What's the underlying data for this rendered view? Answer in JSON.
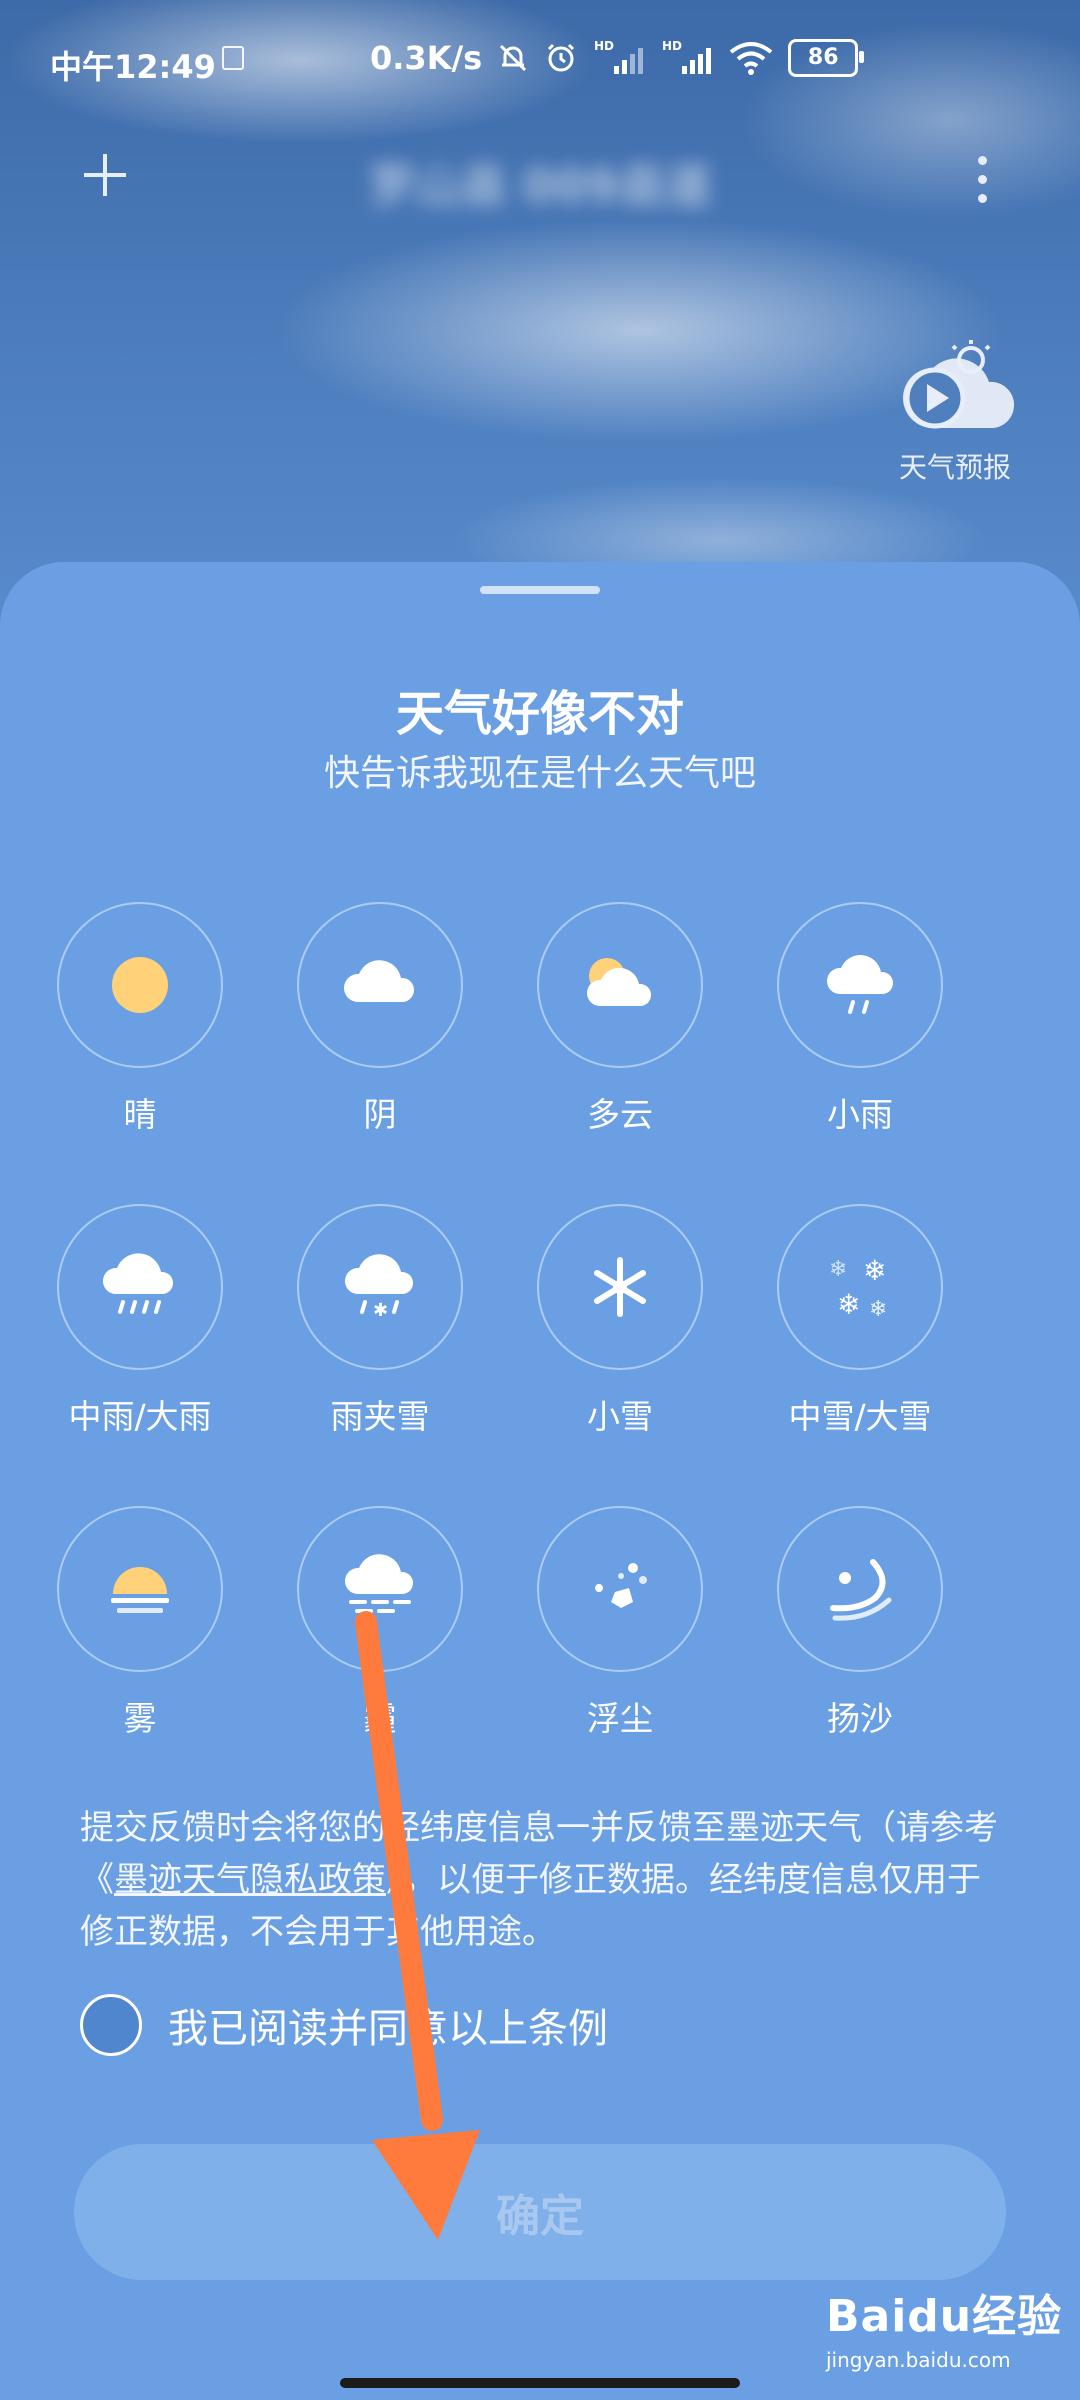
{
  "status_bar": {
    "time": "中午12:49",
    "net_speed": "0.3K/s",
    "signal_tag_1": "HD",
    "signal_tag_2": "HD",
    "battery": "86"
  },
  "header": {
    "city_blurred": "罗山县 009县道",
    "forecast_label": "天气预报"
  },
  "sheet": {
    "title": "天气好像不对",
    "subtitle": "快告诉我现在是什么天气吧",
    "options": [
      {
        "label": "晴",
        "icon": "sun-icon"
      },
      {
        "label": "阴",
        "icon": "cloud-icon"
      },
      {
        "label": "多云",
        "icon": "partly-cloudy-icon"
      },
      {
        "label": "小雨",
        "icon": "light-rain-icon"
      },
      {
        "label": "中雨/大雨",
        "icon": "heavy-rain-icon"
      },
      {
        "label": "雨夹雪",
        "icon": "sleet-icon"
      },
      {
        "label": "小雪",
        "icon": "snowflake-icon"
      },
      {
        "label": "中雪/大雪",
        "icon": "heavy-snow-icon"
      },
      {
        "label": "雾",
        "icon": "fog-icon"
      },
      {
        "label": "霾",
        "icon": "haze-icon"
      },
      {
        "label": "浮尘",
        "icon": "dust-icon"
      },
      {
        "label": "扬沙",
        "icon": "sandstorm-icon"
      }
    ],
    "notice_part1": "提交反馈时会将您的经纬度信息一并反馈至墨迹天气（请参考《",
    "notice_link": "墨迹天气隐私政策",
    "notice_part2": "》，以便于修正数据。经纬度信息仅用于修正数据，不会用于其他用途。",
    "agree_label": "我已阅读并同意以上条例",
    "confirm_label": "确定"
  },
  "watermark": {
    "brand": "Baidu经验",
    "url": "jingyan.baidu.com"
  },
  "colors": {
    "sheet_bg": "#6aa0e3",
    "sun": "#ffd27a",
    "arrow": "#ff7a3d"
  }
}
